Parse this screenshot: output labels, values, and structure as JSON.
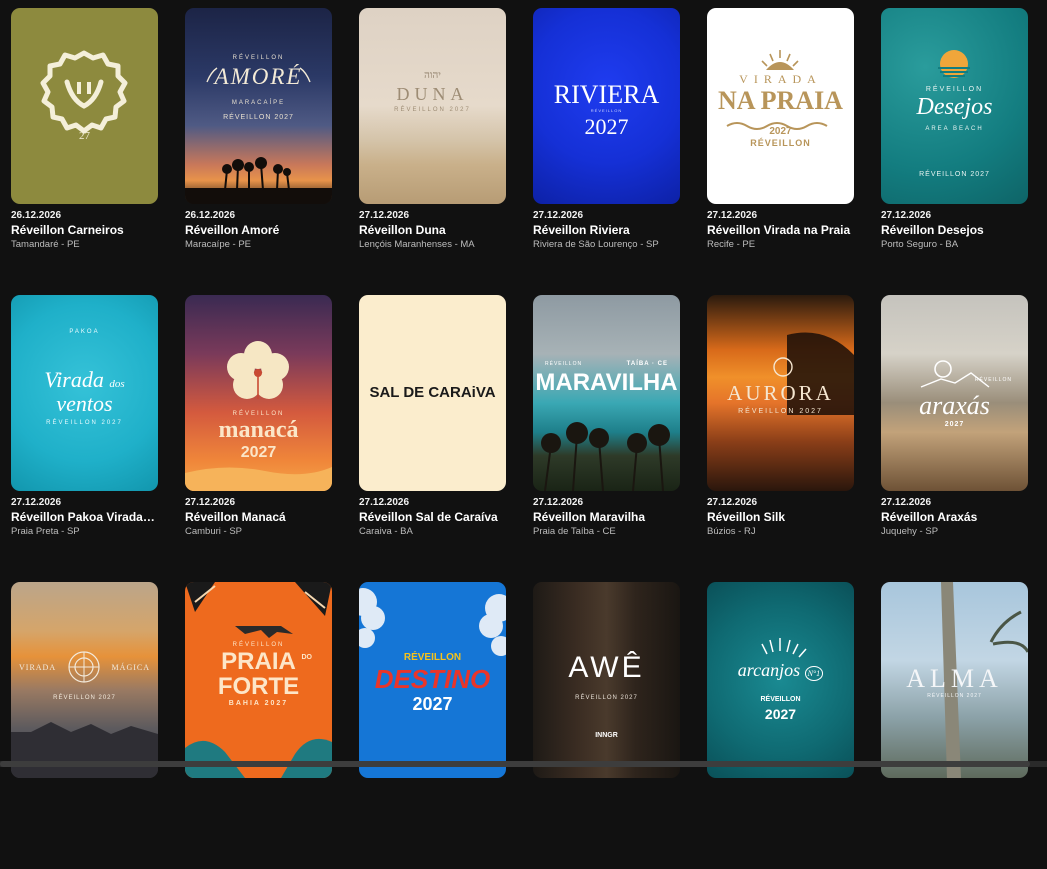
{
  "events": [
    {
      "date": "26.12.2026",
      "name": "Réveillon Carneiros",
      "location": "Tamandaré - PE",
      "poster": {
        "number": "27"
      }
    },
    {
      "date": "26.12.2026",
      "name": "Réveillon Amoré",
      "location": "Maracaípe - PE",
      "poster": {
        "top": "RÉVEILLON",
        "word": "AMORÉ",
        "place": "MARACAÍPE",
        "year": "RÉVEILLON 2027"
      }
    },
    {
      "date": "27.12.2026",
      "name": "Réveillon Duna",
      "location": "Lençóis Maranhenses - MA",
      "poster": {
        "mark": "יהוה",
        "word": "DUNA",
        "year": "RÉVEILLON 2027"
      }
    },
    {
      "date": "27.12.2026",
      "name": "Réveillon Riviera",
      "location": "Riviera de São Lourenço - SP",
      "poster": {
        "word": "RIVIERA",
        "small": "RÉVEILLON",
        "year": "2027"
      }
    },
    {
      "date": "27.12.2026",
      "name": "Réveillon Virada na Praia",
      "location": "Recife - PE",
      "poster": {
        "top": "VIRADA",
        "word": "NA PRAIA",
        "year": "2027",
        "bottom": "RÉVEILLON"
      }
    },
    {
      "date": "27.12.2026",
      "name": "Réveillon Desejos",
      "location": "Porto Seguro - BA",
      "poster": {
        "top": "RÉVEILLON",
        "word": "Desejos",
        "place": "AREA BEACH",
        "year": "RÉVEILLON 2027"
      }
    },
    {
      "date": "27.12.2026",
      "name": "Réveillon Pakoa Virada dos Ventos",
      "location": "Praia Preta - SP",
      "poster": {
        "brand": "PAKOA",
        "word1": "Virada",
        "word2": "dos",
        "word3": "ventos",
        "year": "RÉVEILLON 2027"
      }
    },
    {
      "date": "27.12.2026",
      "name": "Réveillon Manacá",
      "location": "Camburi - SP",
      "poster": {
        "top": "RÉVEILLON",
        "word": "manacá",
        "year": "2027"
      }
    },
    {
      "date": "27.12.2026",
      "name": "Réveillon Sal de Caraíva",
      "location": "Caraiva - BA",
      "poster": {
        "word": "SAL DE CARAiVA"
      }
    },
    {
      "date": "27.12.2026",
      "name": "Réveillon Maravilha",
      "location": "Praia de Taíba - CE",
      "poster": {
        "top": "RÉVEILLON",
        "place": "TAÍBA · CE",
        "word": "MARAVILHA"
      }
    },
    {
      "date": "27.12.2026",
      "name": "Réveillon Silk",
      "location": "Búzios - RJ",
      "poster": {
        "word": "AURORA",
        "year": "RÉVEILLON 2027"
      }
    },
    {
      "date": "27.12.2026",
      "name": "Réveillon Araxás",
      "location": "Juquehy - SP",
      "poster": {
        "top": "RÉVEILLON",
        "word": "araxás",
        "year": "2027"
      }
    },
    {
      "date": "",
      "name": "",
      "location": "",
      "poster": {
        "word1": "VIRADA",
        "word2": "MÁGICA",
        "year": "RÉVEILLON 2027"
      }
    },
    {
      "date": "",
      "name": "",
      "location": "",
      "poster": {
        "top": "RÉVEILLON",
        "word1": "PRAIA",
        "word2": "FORTE",
        "do": "DO",
        "place": "BAHIA 2027"
      }
    },
    {
      "date": "",
      "name": "",
      "location": "",
      "poster": {
        "top": "RÉVEILLON",
        "word": "DESTINO",
        "year": "2027"
      }
    },
    {
      "date": "",
      "name": "",
      "location": "",
      "poster": {
        "word": "AWÊ",
        "year": "RÉVEILLON 2027",
        "brand": "INNGR"
      }
    },
    {
      "date": "",
      "name": "",
      "location": "",
      "poster": {
        "word": "arcanjos",
        "num": "N°1",
        "top": "RÉVEILLON",
        "year": "2027"
      }
    },
    {
      "date": "",
      "name": "",
      "location": "",
      "poster": {
        "word": "ALMA",
        "year": "RÉVEILLON 2027"
      }
    }
  ],
  "colors": {
    "background": "#111111",
    "accent": "#ffffff"
  }
}
